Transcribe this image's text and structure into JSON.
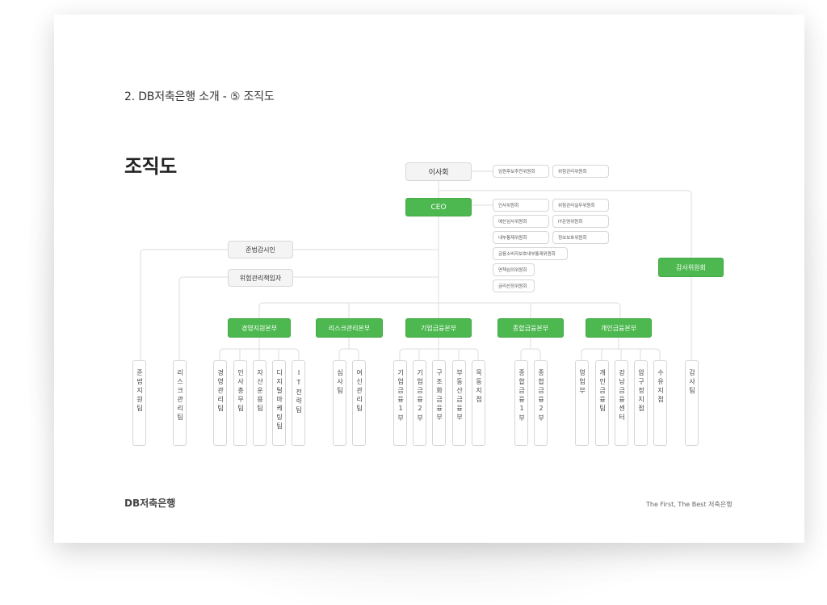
{
  "section_title": "2. DB저축은행 소개 - ⑤ 조직도",
  "page_title": "조직도",
  "footer": {
    "logo": "DB저축은행",
    "slogan": "The First, The Best 저축은행"
  },
  "colors": {
    "accent_green": "#4cb84f",
    "line_gray": "#dcdcdc",
    "box_gray": "#f4f4f4"
  },
  "org": {
    "board": "이사회",
    "board_committees": [
      "임원후보추천위원회",
      "위험관리위원회"
    ],
    "ceo": "CEO",
    "ceo_committees": [
      "인사위원회",
      "위험관리실무위원회",
      "예산심사위원회",
      "IT운영위원회",
      "내부통제위원회",
      "정보보호위원회",
      "금융소비자보호내부통제위원회",
      "면책심의위원회",
      "금리산정위원회"
    ],
    "compliance_officer": "준법감시인",
    "risk_officer": "위험관리책임자",
    "audit_committee": "감사위원회",
    "divisions": [
      {
        "name": "경영지원본부",
        "teams": [
          "경영관리팀",
          "인사총무팀",
          "자산운용팀",
          "디지털마케팅팀",
          "IT전략팀"
        ]
      },
      {
        "name": "리스크관리본부",
        "teams": [
          "심사팀",
          "여신관리팀"
        ]
      },
      {
        "name": "기업금융본부",
        "teams": [
          "기업금융1부",
          "기업금융2부",
          "구조화금융부",
          "부동산금융부",
          "목동지점"
        ]
      },
      {
        "name": "종합금융본부",
        "teams": [
          "종합금융1부",
          "종합금융2부"
        ]
      },
      {
        "name": "개인금융본부",
        "teams": [
          "영업부",
          "개인금융팀",
          "강남금융센터",
          "압구정지점",
          "수유지점"
        ]
      }
    ],
    "compliance_team": "준법지원팀",
    "risk_team": "리스크관리팀",
    "audit_team": "감사팀"
  }
}
